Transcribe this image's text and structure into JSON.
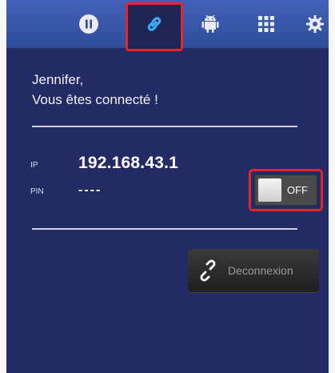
{
  "toolbar": {
    "items": [
      {
        "name": "pause-icon"
      },
      {
        "name": "link-icon",
        "selected": true
      },
      {
        "name": "android-icon"
      },
      {
        "name": "grid-icon"
      },
      {
        "name": "gear-icon"
      }
    ],
    "highlight_color": "#e8232a"
  },
  "connection": {
    "greeting_name": "Jennifer,",
    "greeting_status": "Vous êtes connecté !",
    "ip_label": "IP",
    "ip_value": "192.168.43.1",
    "pin_label": "PIN",
    "pin_value": "----"
  },
  "toggle": {
    "label": "OFF",
    "state": "off"
  },
  "disconnect_button": {
    "label": "Deconnexion",
    "icon": "broken-link-icon"
  },
  "colors": {
    "background": "#232b65",
    "toolbar": "#3a58ae",
    "accent_red": "#e8232a"
  }
}
